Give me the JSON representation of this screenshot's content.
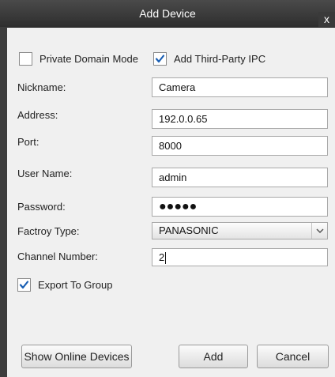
{
  "dialog": {
    "title": "Add Device",
    "close_glyph": "x"
  },
  "options": {
    "private_domain_mode": {
      "label": "Private Domain Mode",
      "checked": false
    },
    "add_third_party_ipc": {
      "label": "Add Third-Party IPC",
      "checked": true
    },
    "export_to_group": {
      "label": "Export To Group",
      "checked": true
    }
  },
  "form": {
    "nickname": {
      "label": "Nickname:",
      "value": "Camera"
    },
    "address": {
      "label": "Address:",
      "value": "192.0.0.65"
    },
    "port": {
      "label": "Port:",
      "value": "8000"
    },
    "user_name": {
      "label": "User Name:",
      "value": "admin"
    },
    "password": {
      "label": "Password:",
      "value": "●●●●●"
    },
    "factory_type": {
      "label": "Factroy Type:",
      "value": "PANASONIC"
    },
    "channel_number": {
      "label": "Channel Number:",
      "value": "2"
    }
  },
  "buttons": {
    "show_online": "Show Online Devices",
    "add": "Add",
    "cancel": "Cancel"
  },
  "colors": {
    "titlebar": "#3a3a3a",
    "check_accent": "#1a5fb4",
    "background": "#f0f0f0"
  }
}
